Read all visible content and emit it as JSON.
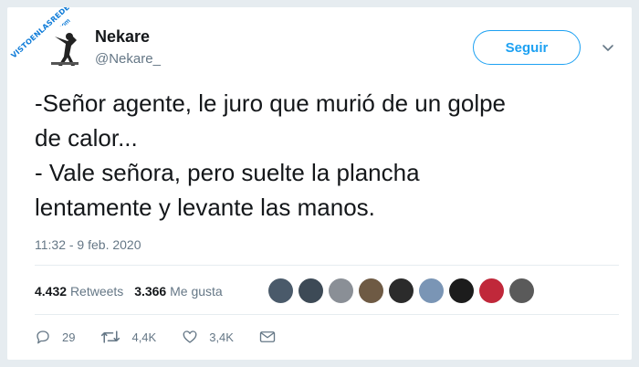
{
  "watermark": {
    "text": "VISTOENLASREDES",
    "suffix": ".com"
  },
  "user": {
    "name": "Nekare",
    "handle": "@Nekare_"
  },
  "follow_label": "Seguir",
  "tweet_text": "-Señor agente, le juro que murió de un golpe\nde calor...\n- Vale señora, pero suelte la plancha\nlentamente y levante las manos.",
  "timestamp": "11:32 - 9 feb. 2020",
  "stats": {
    "retweets_count": "4.432",
    "retweets_label": "Retweets",
    "likes_count": "3.366",
    "likes_label": "Me gusta"
  },
  "liker_colors": [
    "#4a5a6a",
    "#3d4a56",
    "#8a8f96",
    "#6e5a44",
    "#2b2b2b",
    "#7a95b5",
    "#1c1c1c",
    "#c0283a",
    "#5a5a5a"
  ],
  "actions": {
    "replies": "29",
    "retweets": "4,4K",
    "likes": "3,4K"
  },
  "colors": {
    "accent": "#1da1f2",
    "secondary_text": "#657786",
    "primary_text": "#14171a"
  },
  "icons": [
    "chevron-down-icon",
    "reply-icon",
    "retweet-icon",
    "heart-icon",
    "message-icon"
  ]
}
